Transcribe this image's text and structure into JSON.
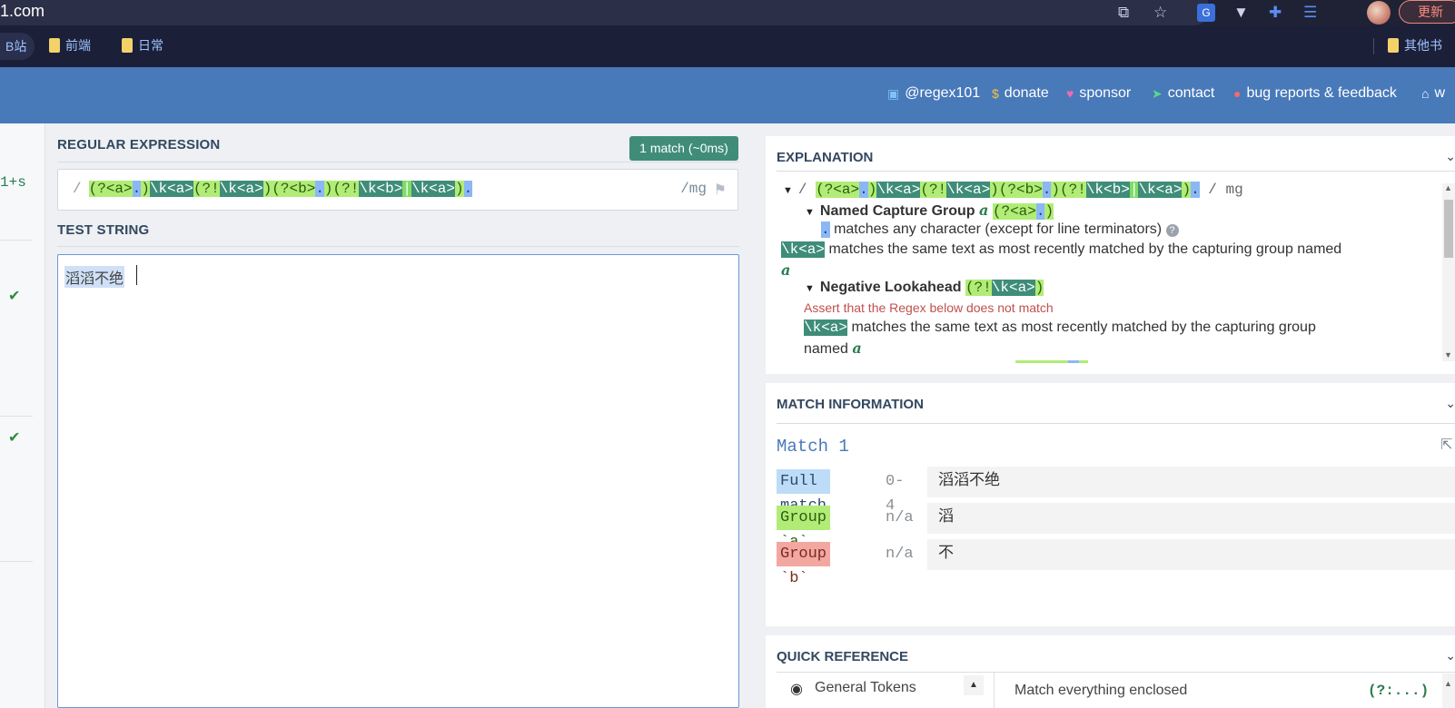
{
  "browser": {
    "url_text": "1.com",
    "update_label": "更新",
    "icons": [
      "translate-icon",
      "star-icon",
      "google-translate-icon",
      "vee-icon",
      "extensions-icon",
      "reading-list-icon",
      "avatar",
      "update-button"
    ]
  },
  "bookmarks": {
    "first": "B站",
    "items": [
      "前端",
      "日常"
    ],
    "other": "其他书"
  },
  "header": {
    "links": [
      "@regex101",
      "donate",
      "sponsor",
      "contact",
      "bug reports & feedback",
      "w"
    ]
  },
  "sidebar": {
    "peek_text": "1+s"
  },
  "regex": {
    "section_title": "REGULAR EXPRESSION",
    "match_badge": "1 match (~0ms)",
    "delimiter": "/",
    "flags_delimiter": "/",
    "flags": "mg",
    "tokens": [
      {
        "text": "(?<a>",
        "kind": "grp"
      },
      {
        "text": ".",
        "kind": "dot"
      },
      {
        "text": ")",
        "kind": "grp"
      },
      {
        "text": "\\k<a>",
        "kind": "ref"
      },
      {
        "text": "(?!",
        "kind": "grp"
      },
      {
        "text": "\\k<a>",
        "kind": "ref"
      },
      {
        "text": ")",
        "kind": "grp"
      },
      {
        "text": "(?<b>",
        "kind": "grp"
      },
      {
        "text": ".",
        "kind": "dot"
      },
      {
        "text": ")",
        "kind": "grp"
      },
      {
        "text": "(?!",
        "kind": "grp"
      },
      {
        "text": "\\k<b>",
        "kind": "ref"
      },
      {
        "text": "|",
        "kind": "alt"
      },
      {
        "text": "\\k<a>",
        "kind": "ref"
      },
      {
        "text": ")",
        "kind": "grp"
      },
      {
        "text": ".",
        "kind": "dot"
      }
    ]
  },
  "test": {
    "section_title": "TEST STRING",
    "value": "滔滔不绝"
  },
  "explanation": {
    "title": "EXPLANATION",
    "root_flags": "/ mg",
    "named_group_label": "Named Capture Group",
    "named_group_name": "a",
    "named_group_token": "(?<a>.)",
    "dot_desc": "matches any character (except for line terminators)",
    "ref_token": "\\k<a>",
    "ref_desc": "matches the same text as most recently matched by the capturing group named",
    "ref_name": "a",
    "neg_label": "Negative Lookahead",
    "neg_token_open": "(?!",
    "neg_token_ref": "\\k<a>",
    "neg_token_close": ")",
    "assert_text": "Assert that the Regex below does not match",
    "ref2_desc": "matches the same text as most recently matched by the capturing group",
    "ref2_tail": "named",
    "ref2_name": "a"
  },
  "match_info": {
    "title": "MATCH INFORMATION",
    "match_title": "Match 1",
    "rows": [
      {
        "label": "Full match",
        "range": "0-4",
        "value": "滔滔不绝"
      },
      {
        "label": "Group `a`",
        "range": "n/a",
        "value": "滔"
      },
      {
        "label": "Group `b`",
        "range": "n/a",
        "value": "不"
      }
    ]
  },
  "quick_ref": {
    "title": "QUICK REFERENCE",
    "category": "General Tokens",
    "item_desc": "Match everything enclosed",
    "item_token": "(?:...)"
  },
  "colors": {
    "header": "#4879b9",
    "group": "#b1ec77",
    "dot": "#8cb7f5",
    "backref": "#3f8d79",
    "badge": "#3f8d79"
  }
}
